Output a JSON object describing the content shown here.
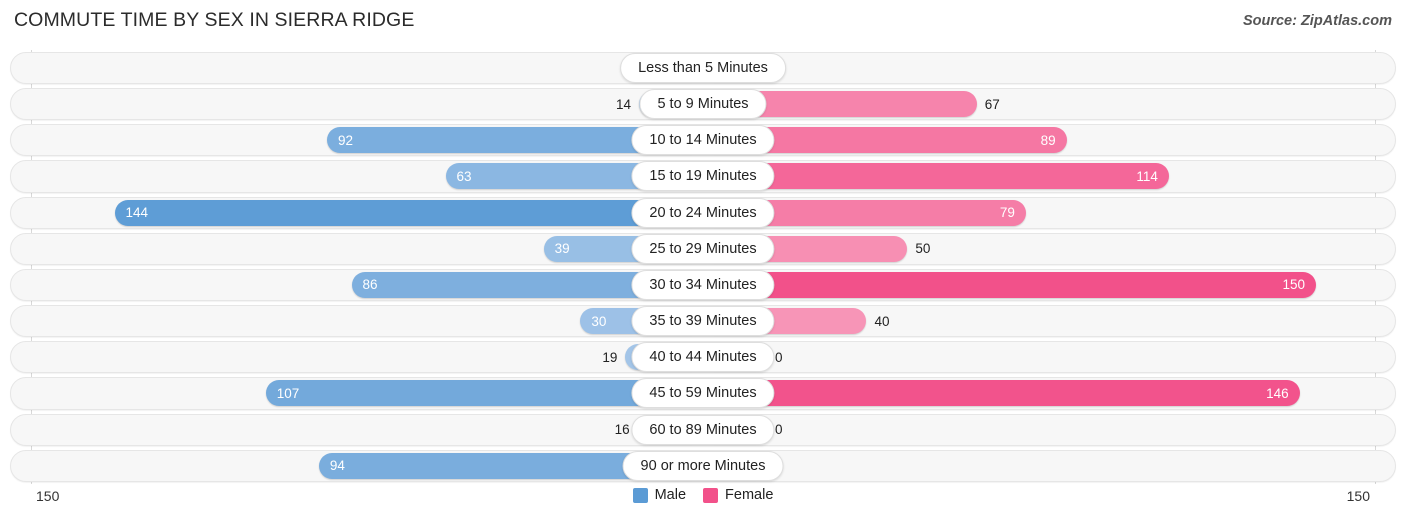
{
  "header": {
    "title": "COMMUTE TIME BY SEX IN SIERRA RIDGE",
    "source": "Source: ZipAtlas.com"
  },
  "axis": {
    "left_min_label": "150",
    "right_min_label": "150",
    "max": 150
  },
  "legend": {
    "items": [
      {
        "label": "Male",
        "color": "#5b9bd5"
      },
      {
        "label": "Female",
        "color": "#f2518a"
      }
    ]
  },
  "colors": {
    "male_dark": "#5b9bd5",
    "male_light": "#aecbeb",
    "female_dark": "#f2518a",
    "female_light": "#f9aec8",
    "track_fill": "#f7f7f7",
    "track_border": "#e6e6e6",
    "gridline": "#d8d8d8"
  },
  "chart_data": {
    "type": "bar",
    "title": "COMMUTE TIME BY SEX IN SIERRA RIDGE",
    "subtitle": "",
    "orientation": "horizontal-diverging",
    "xlabel": "",
    "ylabel": "",
    "xlim": [
      150,
      0,
      150
    ],
    "grid": true,
    "legend_position": "bottom-center",
    "categories": [
      "Less than 5 Minutes",
      "5 to 9 Minutes",
      "10 to 14 Minutes",
      "15 to 19 Minutes",
      "20 to 24 Minutes",
      "25 to 29 Minutes",
      "30 to 34 Minutes",
      "35 to 39 Minutes",
      "40 to 44 Minutes",
      "45 to 59 Minutes",
      "60 to 89 Minutes",
      "90 or more Minutes"
    ],
    "series": [
      {
        "name": "Male",
        "color": "#5b9bd5",
        "values": [
          0,
          14,
          92,
          63,
          144,
          39,
          86,
          30,
          19,
          107,
          16,
          94
        ]
      },
      {
        "name": "Female",
        "color": "#f2518a",
        "values": [
          0,
          67,
          89,
          114,
          79,
          50,
          150,
          40,
          0,
          146,
          0,
          0
        ]
      }
    ]
  }
}
